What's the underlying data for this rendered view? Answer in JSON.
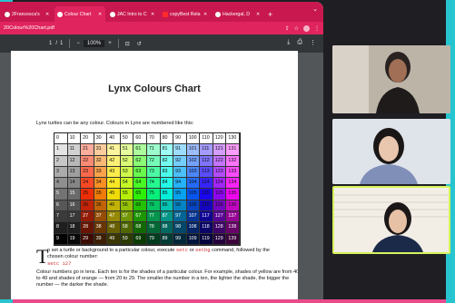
{
  "tabs": [
    {
      "label": "2Francesca's",
      "icon": "doc-icon",
      "active": false
    },
    {
      "label": "Colour Chart",
      "icon": "chrome-icon",
      "active": true
    },
    {
      "label": "JAC Intro to C",
      "icon": "doc-icon",
      "active": false
    },
    {
      "label": "copyBest Rela",
      "icon": "youtube-icon",
      "active": false
    },
    {
      "label": "Hackergal, D",
      "icon": "chrome-icon",
      "active": false
    }
  ],
  "address": {
    "url": "20Colour%20Chart.pdf"
  },
  "pdf_toolbar": {
    "page_current": "1",
    "page_sep": "/",
    "page_total": "1",
    "zoom": "100%"
  },
  "pdf": {
    "title": "Lynx Colours Chart",
    "intro": "Lynx turtles can be any colour. Colours in Lynx are numbered like this:",
    "grid_rows": [
      [
        "0",
        "10",
        "20",
        "30",
        "40",
        "50",
        "60",
        "70",
        "80",
        "90",
        "100",
        "110",
        "120",
        "130"
      ],
      [
        "1",
        "11",
        "21",
        "31",
        "41",
        "51",
        "61",
        "71",
        "81",
        "91",
        "101",
        "111",
        "121",
        "131"
      ],
      [
        "2",
        "12",
        "22",
        "32",
        "42",
        "52",
        "62",
        "72",
        "82",
        "92",
        "102",
        "112",
        "122",
        "132"
      ],
      [
        "3",
        "13",
        "23",
        "33",
        "43",
        "53",
        "63",
        "73",
        "83",
        "93",
        "103",
        "113",
        "123",
        "133"
      ],
      [
        "4",
        "14",
        "24",
        "34",
        "44",
        "54",
        "64",
        "74",
        "84",
        "94",
        "104",
        "114",
        "124",
        "134"
      ],
      [
        "5",
        "15",
        "25",
        "35",
        "45",
        "55",
        "65",
        "75",
        "85",
        "95",
        "105",
        "115",
        "125",
        "135"
      ],
      [
        "6",
        "16",
        "26",
        "36",
        "46",
        "56",
        "66",
        "76",
        "86",
        "96",
        "106",
        "116",
        "126",
        "136"
      ],
      [
        "7",
        "17",
        "27",
        "37",
        "47",
        "57",
        "67",
        "77",
        "87",
        "97",
        "107",
        "117",
        "127",
        "137"
      ],
      [
        "8",
        "18",
        "28",
        "38",
        "48",
        "58",
        "68",
        "78",
        "88",
        "98",
        "108",
        "118",
        "128",
        "138"
      ],
      [
        "9",
        "19",
        "29",
        "39",
        "49",
        "59",
        "69",
        "79",
        "89",
        "99",
        "109",
        "119",
        "129",
        "139"
      ]
    ],
    "set_colour_big_letter": "T",
    "set_colour_text_a": "o set a turtle or background to a particular colour, execute",
    "set_colour_cmd1": "setc",
    "set_colour_text_b": "or",
    "set_colour_cmd2": "setbg",
    "set_colour_text_c": "command, followed by the chosen colour number:",
    "set_colour_example": "setc 127",
    "numbers_text": "Colour numbers go in tens. Each ten is for the shades of a particular colour. For example, shades of yellow are from 40 to 49 and shades of orange — from 20 to 29. The smaller the number in a ten, the lighter the shade, the bigger the number — the darker the shade."
  },
  "colors": {
    "tab_bar": "#c8184f",
    "frame_pink": "#e84a8a",
    "frame_cyan": "#27c5cf",
    "active_tile_border": "#d7f25c"
  }
}
